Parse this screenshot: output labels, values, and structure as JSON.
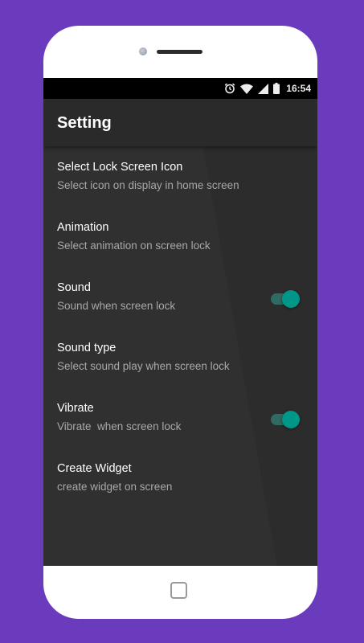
{
  "status_bar": {
    "time": "16:54",
    "icons": [
      "alarm-icon",
      "wifi-icon",
      "signal-icon",
      "battery-icon"
    ]
  },
  "app_bar": {
    "title": "Setting"
  },
  "settings": [
    {
      "title": "Select Lock Screen Icon",
      "subtitle": "Select icon on display in home screen",
      "has_toggle": false
    },
    {
      "title": "Animation",
      "subtitle": "Select animation on screen lock",
      "has_toggle": false
    },
    {
      "title": "Sound",
      "subtitle": "Sound when screen lock",
      "has_toggle": true,
      "toggle_on": true
    },
    {
      "title": "Sound type",
      "subtitle": "Select sound play when screen lock",
      "has_toggle": false
    },
    {
      "title": "Vibrate",
      "subtitle": "Vibrate  when screen lock",
      "has_toggle": true,
      "toggle_on": true
    },
    {
      "title": "Create Widget",
      "subtitle": "create widget on screen",
      "has_toggle": false
    }
  ],
  "colors": {
    "background": "#6a3bbd",
    "accent": "#009688",
    "screen": "#303030",
    "app_bar": "#2a2a2a"
  }
}
